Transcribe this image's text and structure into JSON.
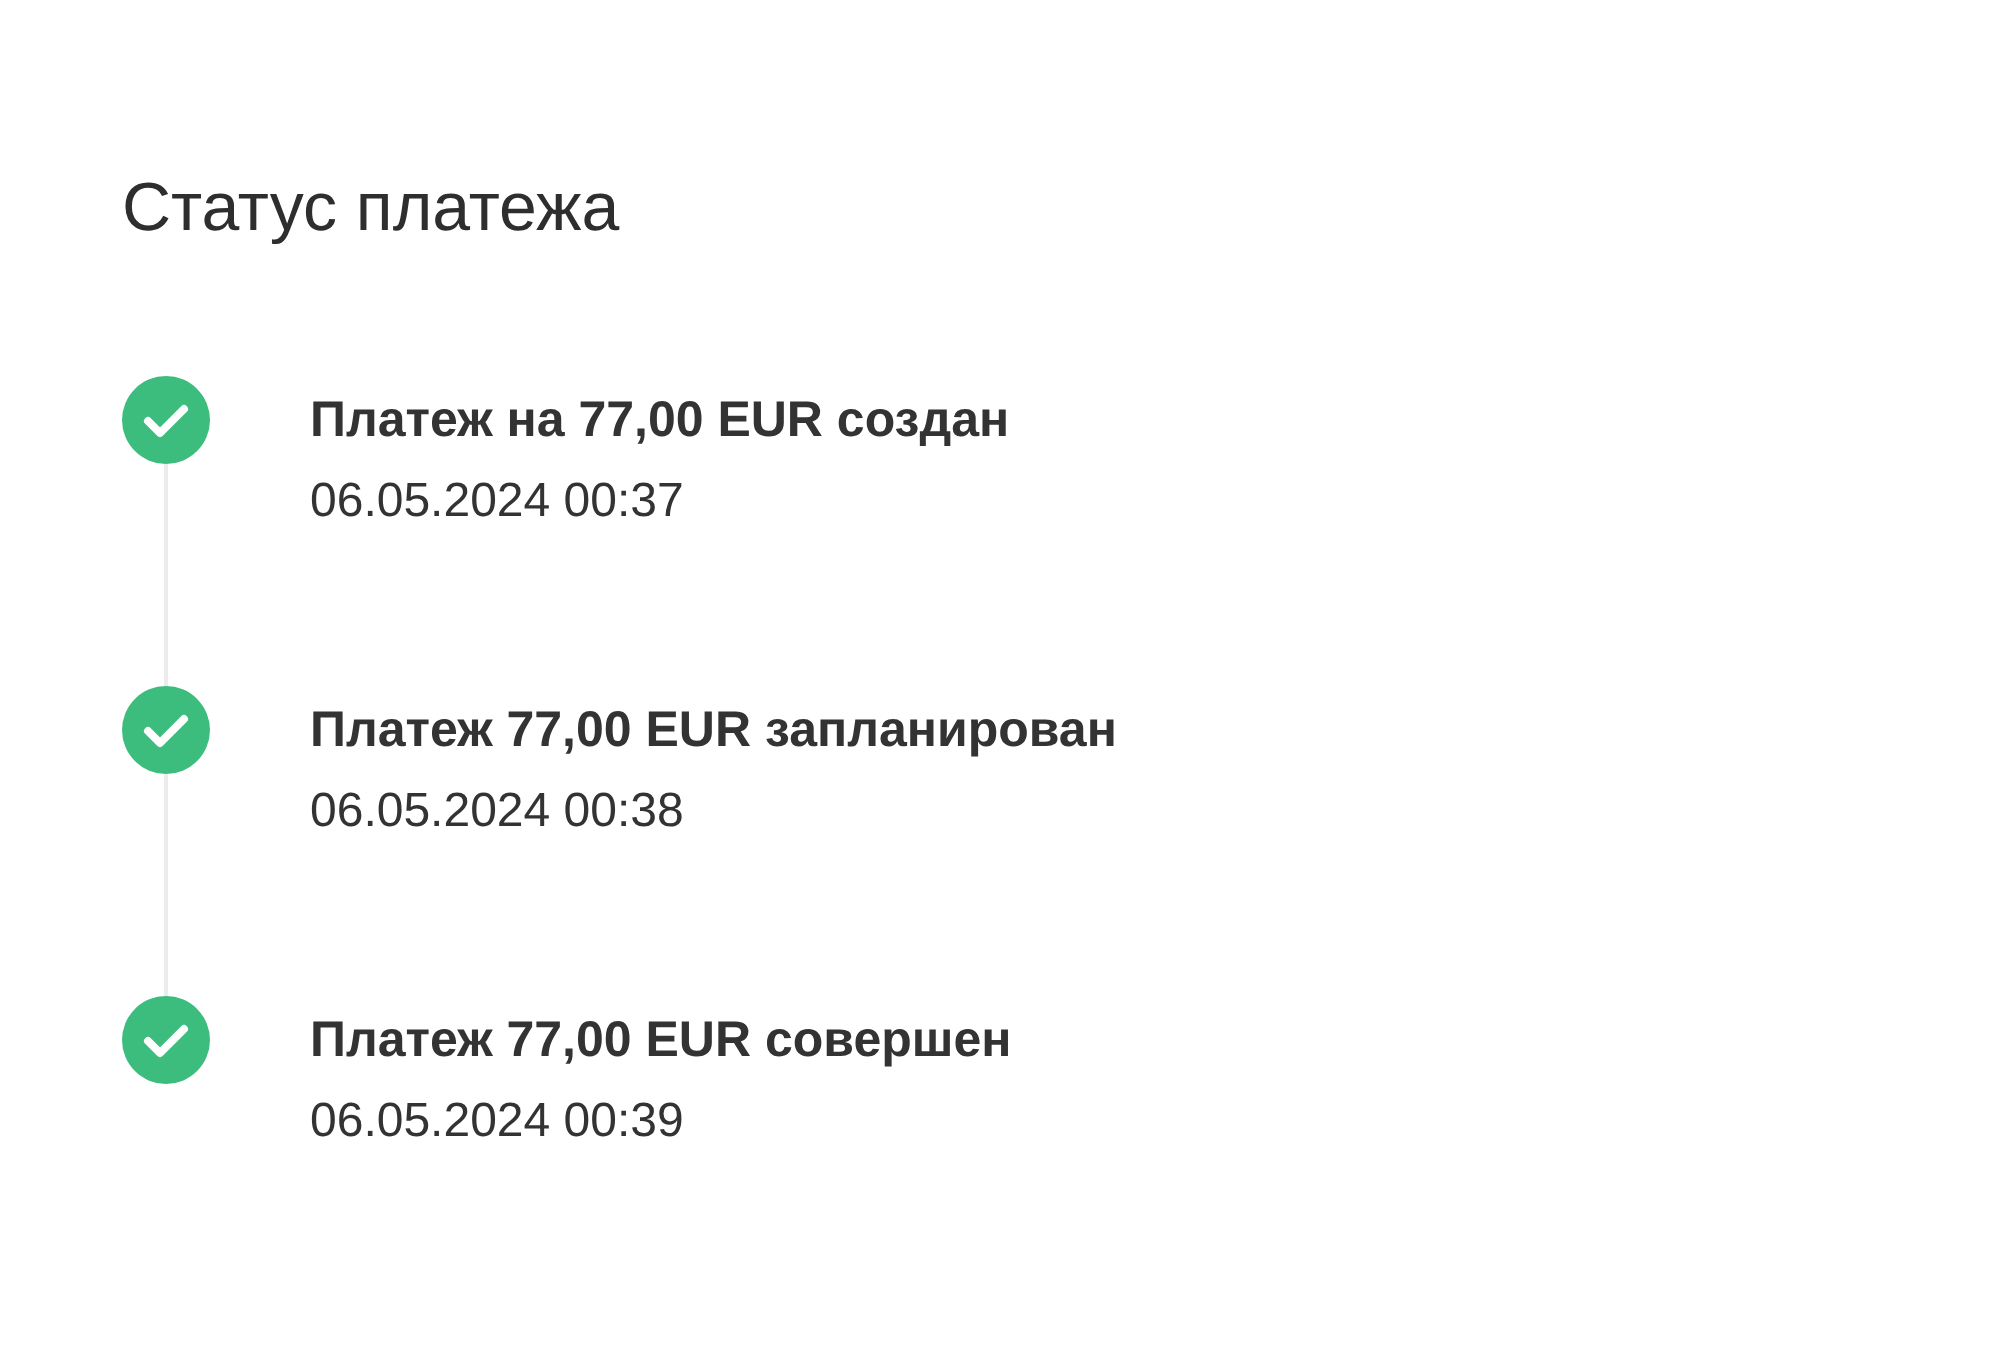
{
  "title": "Статус платежа",
  "steps": [
    {
      "label": "Платеж на 77,00 EUR создан",
      "time": "06.05.2024 00:37",
      "completed": true
    },
    {
      "label": "Платеж 77,00 EUR запланирован",
      "time": "06.05.2024 00:38",
      "completed": true
    },
    {
      "label": "Платеж 77,00 EUR совершен",
      "time": "06.05.2024 00:39",
      "completed": true
    }
  ]
}
